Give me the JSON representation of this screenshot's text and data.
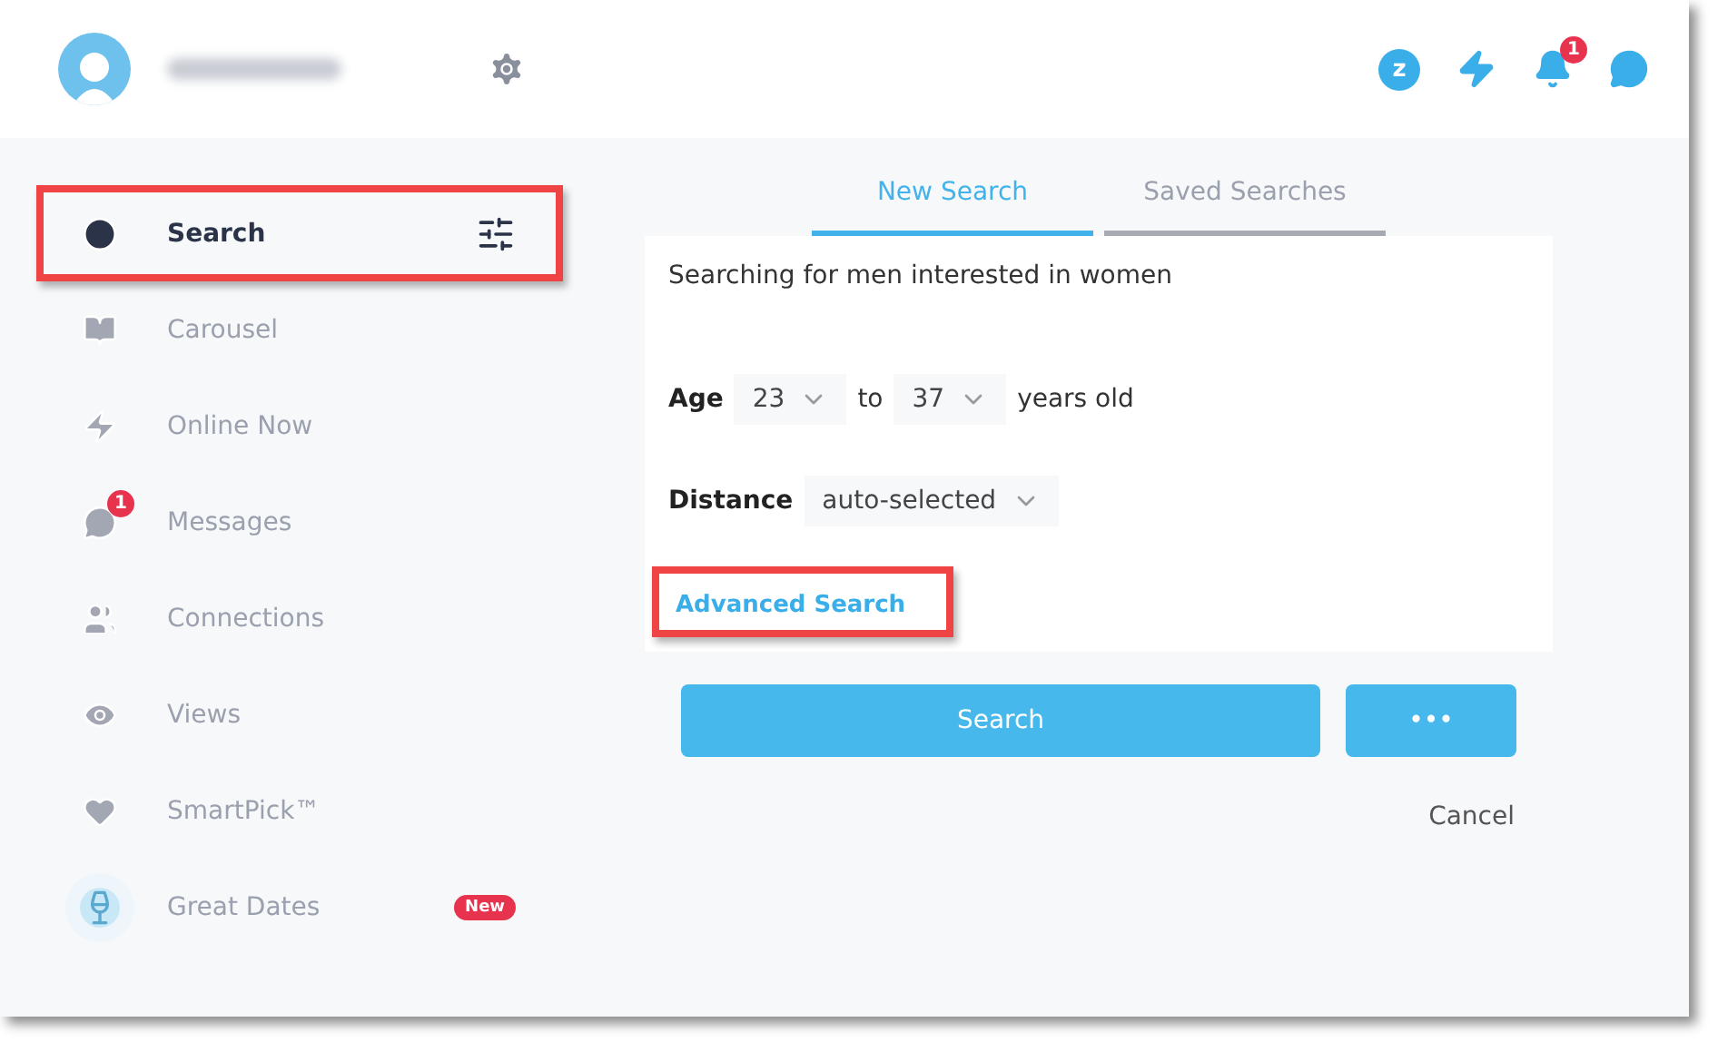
{
  "header": {
    "z_label": "z",
    "notification_count": "1"
  },
  "sidebar": {
    "items": [
      {
        "label": "Search",
        "selected": true,
        "highlighted": true
      },
      {
        "label": "Carousel",
        "selected": false,
        "highlighted": false
      },
      {
        "label": "Online Now",
        "selected": false,
        "highlighted": false
      },
      {
        "label": "Messages",
        "selected": false,
        "highlighted": false,
        "badge": "1"
      },
      {
        "label": "Connections",
        "selected": false,
        "highlighted": false
      },
      {
        "label": "Views",
        "selected": false,
        "highlighted": false
      },
      {
        "label": "SmartPick™",
        "selected": false,
        "highlighted": false
      },
      {
        "label": "Great Dates",
        "selected": false,
        "highlighted": false,
        "tag": "New"
      }
    ]
  },
  "tabs": [
    {
      "label": "New Search",
      "selected": true
    },
    {
      "label": "Saved Searches",
      "selected": false
    }
  ],
  "search_form": {
    "summary": "Searching for men interested in women",
    "age": {
      "label": "Age",
      "from": "23",
      "to_label": "to",
      "to": "37",
      "suffix": "years old"
    },
    "distance": {
      "label": "Distance",
      "value": "auto-selected"
    },
    "advanced_link": {
      "label": "Advanced Search",
      "highlighted": true
    }
  },
  "buttons": {
    "search": "Search",
    "more": "•••",
    "cancel": "Cancel"
  }
}
